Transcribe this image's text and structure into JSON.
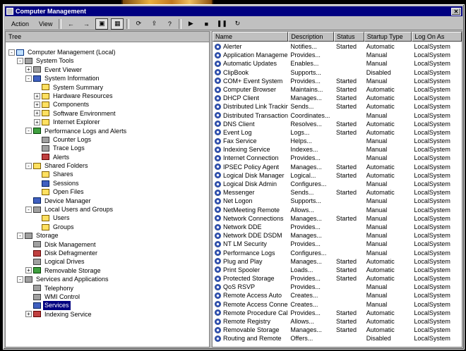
{
  "window": {
    "title": "Computer Management"
  },
  "toolbar": {
    "menus": [
      "Action",
      "View"
    ],
    "buttons": [
      "back-icon",
      "forward-icon",
      "up-folder-icon",
      "properties-icon",
      "refresh-icon",
      "export-icon",
      "help-icon",
      "play-icon",
      "stop-icon",
      "pause-icon",
      "restart-icon"
    ]
  },
  "left_pane": {
    "header": "Tree",
    "items": [
      {
        "label": "Computer Management (Local)",
        "level": 0,
        "icon": "monitor",
        "expander": "-"
      },
      {
        "label": "System Tools",
        "level": 1,
        "icon": "gray",
        "expander": "-"
      },
      {
        "label": "Event Viewer",
        "level": 2,
        "icon": "gray",
        "expander": "+"
      },
      {
        "label": "System Information",
        "level": 2,
        "icon": "blue",
        "expander": "-"
      },
      {
        "label": "System Summary",
        "level": 3,
        "icon": "folder",
        "expander": ""
      },
      {
        "label": "Hardware Resources",
        "level": 3,
        "icon": "folder",
        "expander": "+"
      },
      {
        "label": "Components",
        "level": 3,
        "icon": "folder",
        "expander": "+"
      },
      {
        "label": "Software Environment",
        "level": 3,
        "icon": "folder",
        "expander": "+"
      },
      {
        "label": "Internet Explorer",
        "level": 3,
        "icon": "folder",
        "expander": "+"
      },
      {
        "label": "Performance Logs and Alerts",
        "level": 2,
        "icon": "green",
        "expander": "-"
      },
      {
        "label": "Counter Logs",
        "level": 3,
        "icon": "gray",
        "expander": ""
      },
      {
        "label": "Trace Logs",
        "level": 3,
        "icon": "gray",
        "expander": ""
      },
      {
        "label": "Alerts",
        "level": 3,
        "icon": "red",
        "expander": ""
      },
      {
        "label": "Shared Folders",
        "level": 2,
        "icon": "folder",
        "expander": "-"
      },
      {
        "label": "Shares",
        "level": 3,
        "icon": "folder",
        "expander": ""
      },
      {
        "label": "Sessions",
        "level": 3,
        "icon": "blue",
        "expander": ""
      },
      {
        "label": "Open Files",
        "level": 3,
        "icon": "folder",
        "expander": ""
      },
      {
        "label": "Device Manager",
        "level": 2,
        "icon": "blue",
        "expander": ""
      },
      {
        "label": "Local Users and Groups",
        "level": 2,
        "icon": "gray",
        "expander": "-"
      },
      {
        "label": "Users",
        "level": 3,
        "icon": "folder",
        "expander": ""
      },
      {
        "label": "Groups",
        "level": 3,
        "icon": "folder",
        "expander": ""
      },
      {
        "label": "Storage",
        "level": 1,
        "icon": "gray",
        "expander": "-"
      },
      {
        "label": "Disk Management",
        "level": 2,
        "icon": "gray",
        "expander": ""
      },
      {
        "label": "Disk Defragmenter",
        "level": 2,
        "icon": "red",
        "expander": ""
      },
      {
        "label": "Logical Drives",
        "level": 2,
        "icon": "gray",
        "expander": ""
      },
      {
        "label": "Removable Storage",
        "level": 2,
        "icon": "green",
        "expander": "+"
      },
      {
        "label": "Services and Applications",
        "level": 1,
        "icon": "gray",
        "expander": "-"
      },
      {
        "label": "Telephony",
        "level": 2,
        "icon": "gray",
        "expander": ""
      },
      {
        "label": "WMI Control",
        "level": 2,
        "icon": "gray",
        "expander": ""
      },
      {
        "label": "Services",
        "level": 2,
        "icon": "blue",
        "expander": "",
        "selected": true
      },
      {
        "label": "Indexing Service",
        "level": 2,
        "icon": "red",
        "expander": "+"
      }
    ]
  },
  "right_pane": {
    "columns": [
      "Name",
      "Description",
      "Status",
      "Startup Type",
      "Log On As"
    ],
    "rows": [
      [
        "Alerter",
        "Notifies...",
        "Started",
        "Automatic",
        "LocalSystem"
      ],
      [
        "Application Management",
        "Provides...",
        "",
        "Manual",
        "LocalSystem"
      ],
      [
        "Automatic Updates",
        "Enables...",
        "",
        "Manual",
        "LocalSystem"
      ],
      [
        "ClipBook",
        "Supports...",
        "",
        "Disabled",
        "LocalSystem"
      ],
      [
        "COM+ Event System",
        "Provides...",
        "Started",
        "Manual",
        "LocalSystem"
      ],
      [
        "Computer Browser",
        "Maintains...",
        "Started",
        "Automatic",
        "LocalSystem"
      ],
      [
        "DHCP Client",
        "Manages...",
        "Started",
        "Automatic",
        "LocalSystem"
      ],
      [
        "Distributed Link Tracking",
        "Sends...",
        "Started",
        "Automatic",
        "LocalSystem"
      ],
      [
        "Distributed Transaction",
        "Coordinates...",
        "",
        "Manual",
        "LocalSystem"
      ],
      [
        "DNS Client",
        "Resolves...",
        "Started",
        "Automatic",
        "LocalSystem"
      ],
      [
        "Event Log",
        "Logs...",
        "Started",
        "Automatic",
        "LocalSystem"
      ],
      [
        "Fax Service",
        "Helps...",
        "",
        "Manual",
        "LocalSystem"
      ],
      [
        "Indexing Service",
        "Indexes...",
        "",
        "Manual",
        "LocalSystem"
      ],
      [
        "Internet Connection",
        "Provides...",
        "",
        "Manual",
        "LocalSystem"
      ],
      [
        "IPSEC Policy Agent",
        "Manages...",
        "Started",
        "Automatic",
        "LocalSystem"
      ],
      [
        "Logical Disk Manager",
        "Logical...",
        "Started",
        "Automatic",
        "LocalSystem"
      ],
      [
        "Logical Disk Admin",
        "Configures...",
        "",
        "Manual",
        "LocalSystem"
      ],
      [
        "Messenger",
        "Sends...",
        "Started",
        "Automatic",
        "LocalSystem"
      ],
      [
        "Net Logon",
        "Supports...",
        "",
        "Manual",
        "LocalSystem"
      ],
      [
        "NetMeeting Remote",
        "Allows...",
        "",
        "Manual",
        "LocalSystem"
      ],
      [
        "Network Connections",
        "Manages...",
        "Started",
        "Manual",
        "LocalSystem"
      ],
      [
        "Network DDE",
        "Provides...",
        "",
        "Manual",
        "LocalSystem"
      ],
      [
        "Network DDE DSDM",
        "Manages...",
        "",
        "Manual",
        "LocalSystem"
      ],
      [
        "NT LM Security",
        "Provides...",
        "",
        "Manual",
        "LocalSystem"
      ],
      [
        "Performance Logs",
        "Configures...",
        "",
        "Manual",
        "LocalSystem"
      ],
      [
        "Plug and Play",
        "Manages...",
        "Started",
        "Automatic",
        "LocalSystem"
      ],
      [
        "Print Spooler",
        "Loads...",
        "Started",
        "Automatic",
        "LocalSystem"
      ],
      [
        "Protected Storage",
        "Provides...",
        "Started",
        "Automatic",
        "LocalSystem"
      ],
      [
        "QoS RSVP",
        "Provides...",
        "",
        "Manual",
        "LocalSystem"
      ],
      [
        "Remote Access Auto",
        "Creates...",
        "",
        "Manual",
        "LocalSystem"
      ],
      [
        "Remote Access Connection",
        "Creates...",
        "",
        "Manual",
        "LocalSystem"
      ],
      [
        "Remote Procedure Call",
        "Provides...",
        "Started",
        "Automatic",
        "LocalSystem"
      ],
      [
        "Remote Registry",
        "Allows...",
        "Started",
        "Automatic",
        "LocalSystem"
      ],
      [
        "Removable Storage",
        "Manages...",
        "Started",
        "Automatic",
        "LocalSystem"
      ],
      [
        "Routing and Remote",
        "Offers...",
        "",
        "Disabled",
        "LocalSystem"
      ]
    ]
  }
}
